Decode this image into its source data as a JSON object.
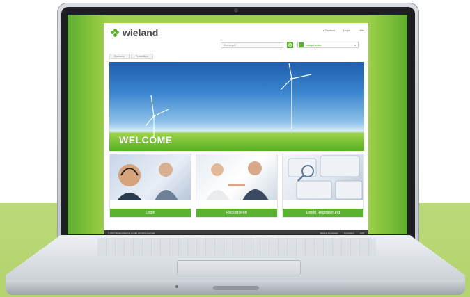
{
  "brand": {
    "name": "wieland",
    "accent": "#5bb130",
    "footer_bg": "#3c3c3c"
  },
  "header": {
    "toplinks": [
      "• Deutsch",
      "Login",
      "Hilfe"
    ],
    "search_placeholder": "Suchbegriff",
    "language_label": "eshop Lenker"
  },
  "nav": {
    "tabs": [
      "Startseite",
      "Produktlinie"
    ]
  },
  "hero": {
    "title": "WELCOME"
  },
  "tiles": [
    {
      "label": "Login"
    },
    {
      "label": "Registrieren"
    },
    {
      "label": "Direkt Registrierung"
    }
  ],
  "footer": {
    "copyright": "© 2013 Wieland Electric GmbH. All rights reserved.",
    "links": [
      "Wieland Homepage",
      "Impressum",
      "AGB"
    ]
  }
}
